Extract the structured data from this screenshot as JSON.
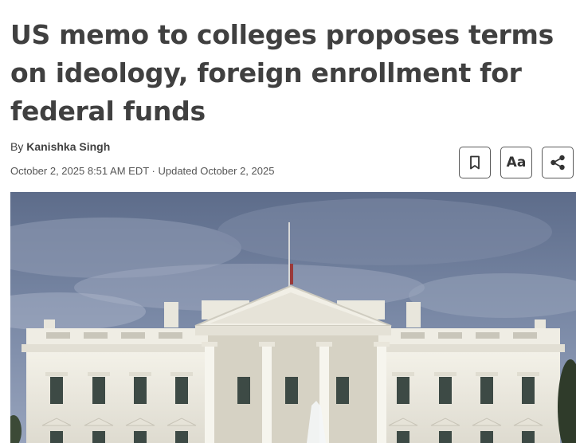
{
  "article": {
    "headline": "US memo to colleges proposes terms on ideology, foreign enrollment for federal funds",
    "byline_prefix": "By",
    "author": "Kanishka Singh",
    "dateline": "October 2, 2025 8:51 AM EDT · Updated October 2, 2025"
  },
  "toolbar": {
    "bookmark_icon": "bookmark-icon",
    "text_size_label": "Aa",
    "share_icon": "share-icon"
  },
  "colors": {
    "text": "#404040",
    "sky": "#6f7f9c",
    "building": "#ecebe3"
  }
}
